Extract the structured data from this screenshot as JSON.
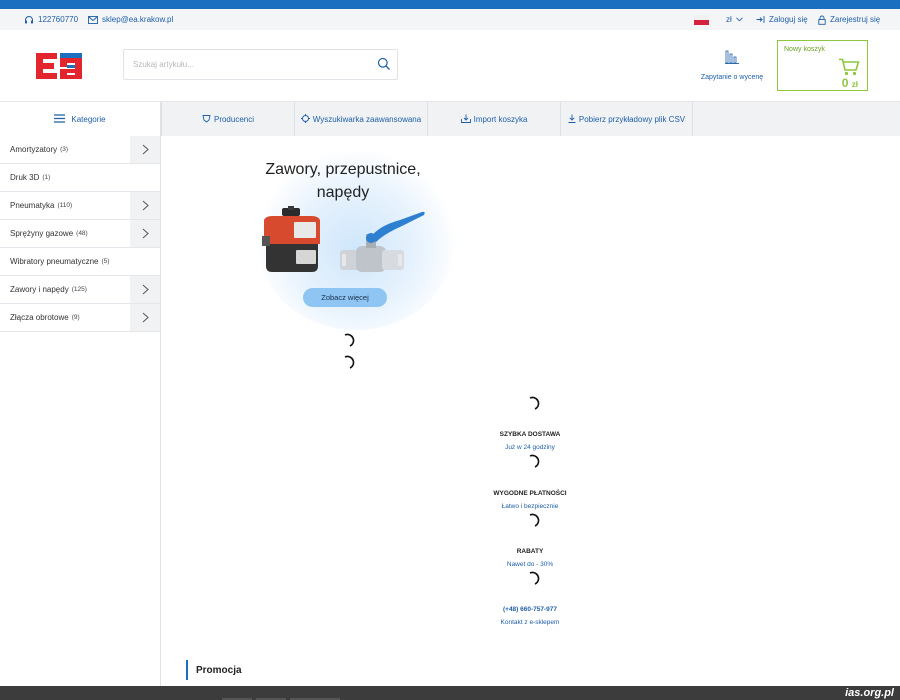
{
  "topbar": {
    "phone": "122760770",
    "email": "sklep@ea.krakow.pl",
    "currency": "zł",
    "login": "Zaloguj się",
    "register": "Zarejestruj się"
  },
  "header": {
    "logo_text": "ea",
    "search_placeholder": "Szukaj artykułu...",
    "quote_label": "Zapytanie o wycenę",
    "cart_title": "Nowy koszyk",
    "cart_amount": "0",
    "cart_currency": "zł"
  },
  "nav": {
    "categories": "Kategorie",
    "tabs": [
      "Producenci",
      "Wyszukiwarka zaawansowana",
      "Import koszyka",
      "Pobierz przykładowy plik CSV"
    ]
  },
  "sidebar": {
    "items": [
      {
        "label": "Amortyzatory",
        "count": "(3)"
      },
      {
        "label": "Druk 3D",
        "count": "(1)"
      },
      {
        "label": "Pneumatyka",
        "count": "(110)"
      },
      {
        "label": "Sprężyny gazowe",
        "count": "(48)"
      },
      {
        "label": "Wibratory pneumatyczne",
        "count": "(5)"
      },
      {
        "label": "Zawory i napędy",
        "count": "(125)"
      },
      {
        "label": "Złącza obrotowe",
        "count": "(9)"
      }
    ]
  },
  "banner": {
    "title_line1": "Zawory, przepustnice,",
    "title_line2": "napędy",
    "button": "Zobacz więcej"
  },
  "features": [
    {
      "title": "SZYBKA DOSTAWA",
      "subtitle": "Już w 24 godziny"
    },
    {
      "title": "WYGODNE PŁATNOŚCI",
      "subtitle": "Łatwo i bezpiecznie"
    },
    {
      "title": "RABATY",
      "subtitle": "Nawet do - 30%"
    },
    {
      "title": "(+48) 660-757-977",
      "subtitle": "Kontakt z e-sklepem"
    }
  ],
  "promo_heading": "Promocja",
  "watermark": "ias.org.pl",
  "colors": {
    "accent": "#1b6fc1",
    "link": "#1f5fa8",
    "cart": "#8dc63f",
    "logo_red": "#e3262d",
    "logo_blue": "#1b6fc1"
  }
}
